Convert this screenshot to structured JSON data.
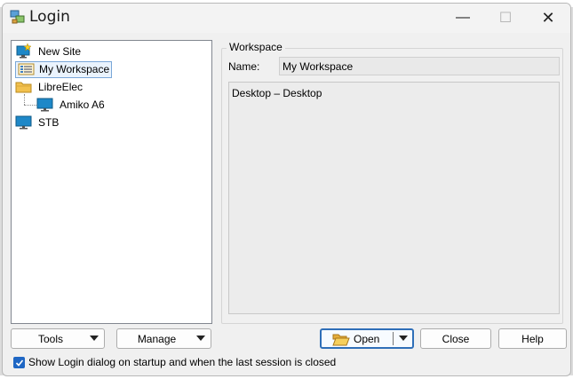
{
  "window": {
    "title": "Login"
  },
  "titlebar": {
    "minimize": "—",
    "maximize": "☐",
    "close": "✕"
  },
  "tree": {
    "items": [
      {
        "label": "New Site",
        "icon": "new-site-icon"
      },
      {
        "label": "My Workspace",
        "icon": "workspace-icon",
        "selected": true
      },
      {
        "label": "LibreElec",
        "icon": "folder-icon"
      },
      {
        "label": "Amiko A6",
        "icon": "monitor-icon"
      },
      {
        "label": "STB",
        "icon": "monitor-icon"
      }
    ]
  },
  "workspace": {
    "group_label": "Workspace",
    "name_label": "Name:",
    "name_value": "My Workspace",
    "description": "Desktop – Desktop"
  },
  "buttons": {
    "tools": "Tools",
    "manage": "Manage",
    "open": "Open",
    "close": "Close",
    "help": "Help"
  },
  "options": {
    "show_login_label": "Show Login dialog on startup and when the last session is closed",
    "show_login_checked": true
  },
  "colors": {
    "accent": "#1f67c4",
    "selection_bg": "#eaf3fd",
    "selection_border": "#7aa7d8",
    "folder": "#f2c14e",
    "monitor": "#1e88c8"
  }
}
